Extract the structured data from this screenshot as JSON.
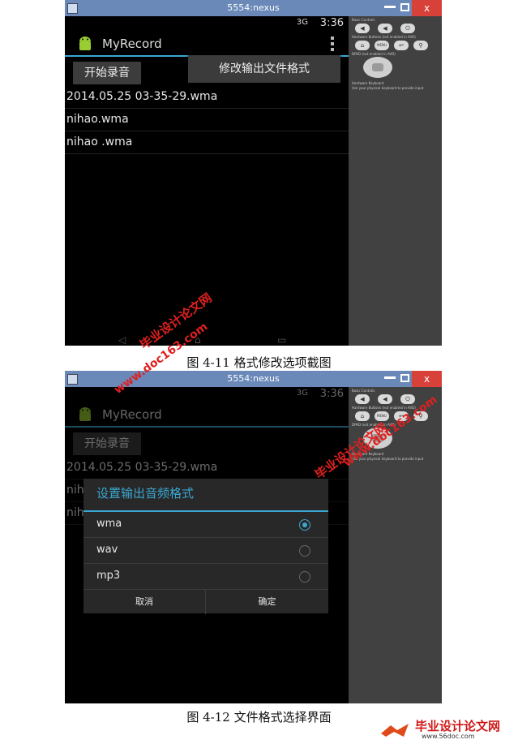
{
  "window": {
    "title": "5554:nexus",
    "close": "x"
  },
  "status": {
    "signal": "3G",
    "time": "3:36"
  },
  "app": {
    "title": "MyRecord",
    "start_button": "开始录音"
  },
  "menu": {
    "item": "修改输出文件格式"
  },
  "files": [
    "2014.05.25 03-35-29.wma",
    "nihao.wma",
    "nihao .wma"
  ],
  "panel": {
    "basic_controls": "Basic Controls",
    "hardware_buttons": "Hardware Buttons (not enabled in AVD)",
    "dpad": "DPAD (not enabled in AVD)",
    "hardware_keyboard": "Hardware Keyboard",
    "keyboard_hint": "Use your physical keyboard to provide input",
    "menu_label": "MENU"
  },
  "dialog": {
    "title": "设置输出音频格式",
    "options": [
      "wma",
      "wav",
      "mp3"
    ],
    "selected": "wma",
    "cancel": "取消",
    "ok": "确定"
  },
  "captions": {
    "fig1": "图  4-11  格式修改选项截图",
    "fig2": "图  4-12  文件格式选择界面"
  },
  "watermarks": {
    "site_cn": "毕业设计论文网",
    "site_url": "www.doc163.com",
    "site_url2": "www.56doc.com"
  },
  "colors": {
    "accent": "#3aa7d2",
    "watermark": "#e02020",
    "titlebar": "#6a88b8"
  }
}
